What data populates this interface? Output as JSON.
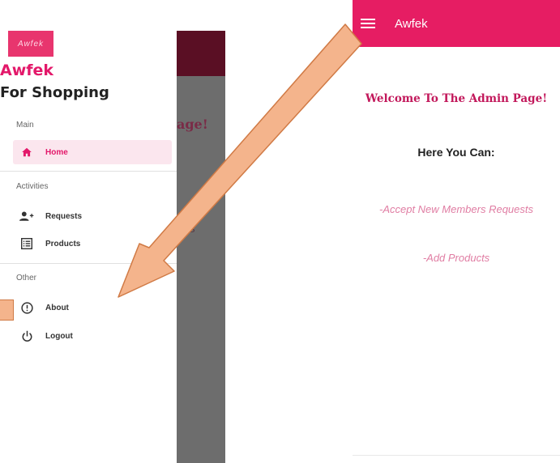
{
  "left_screen": {
    "drawer": {
      "logo_text": "Awfek",
      "brand": "Awfek",
      "tagline": "For Shopping",
      "sections": [
        {
          "label": "Main",
          "items": [
            {
              "label": "Home",
              "icon": "home-icon",
              "active": true
            }
          ]
        },
        {
          "label": "Activities",
          "items": [
            {
              "label": "Requests",
              "icon": "add-person-icon",
              "active": false
            },
            {
              "label": "Products",
              "icon": "list-icon",
              "active": false
            }
          ]
        },
        {
          "label": "Other",
          "items": [
            {
              "label": "About",
              "icon": "info-icon",
              "active": false
            },
            {
              "label": "Logout",
              "icon": "power-icon",
              "active": false
            }
          ]
        }
      ]
    },
    "background_peek": {
      "title_fragment": "age!",
      "text_fragment": "ts"
    }
  },
  "right_screen": {
    "app_title": "Awfek",
    "welcome": "Welcome To The Admin Page!",
    "subtitle": "Here You Can:",
    "features": [
      "-Accept New Members Requests",
      "-Add Products"
    ]
  },
  "colors": {
    "accent": "#e61d63",
    "accent_dark": "#5a0f24",
    "arrow_fill": "#f4b48c",
    "arrow_stroke": "#d07a45"
  }
}
